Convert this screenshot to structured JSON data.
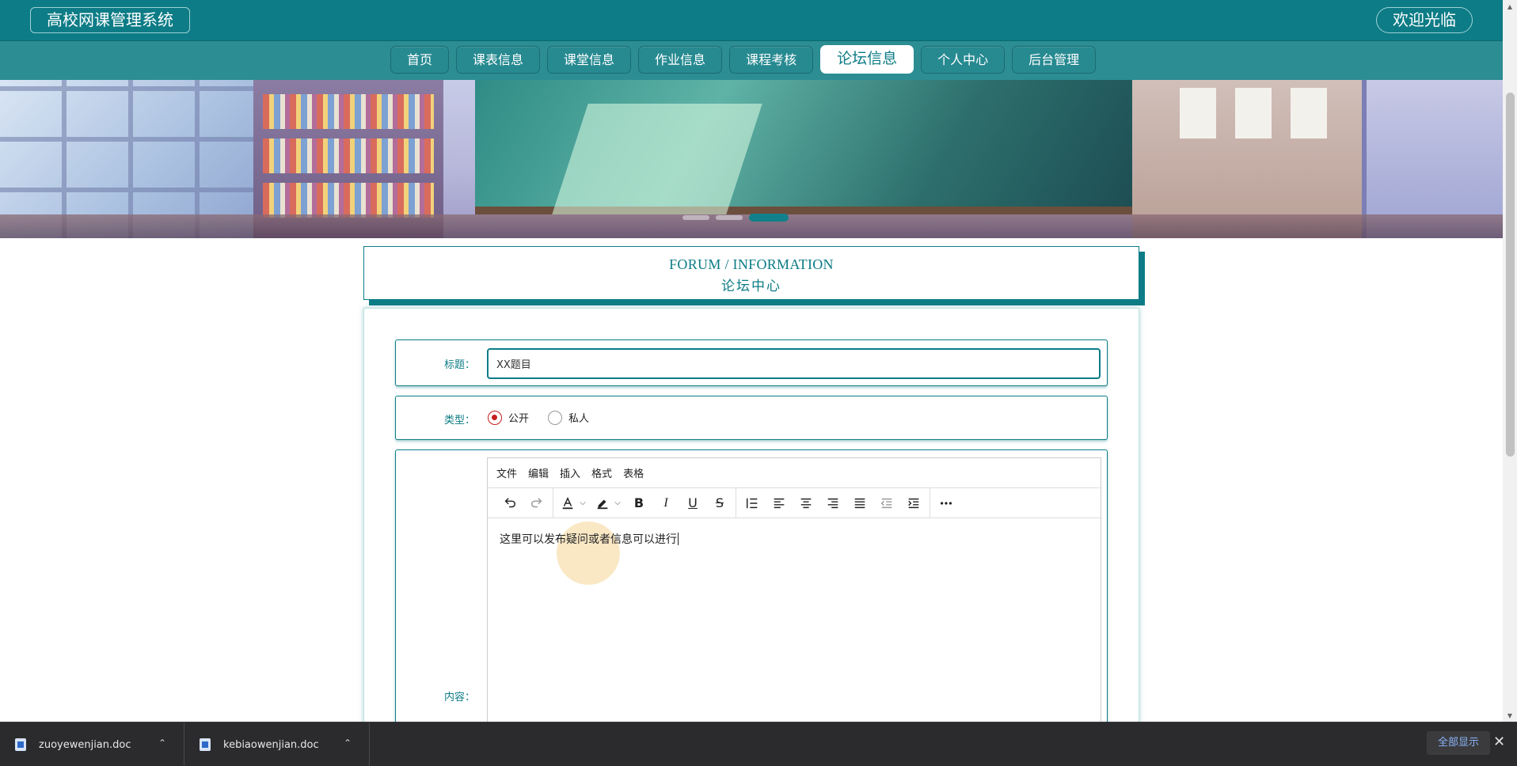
{
  "header": {
    "site_title": "高校网课管理系统",
    "welcome": "欢迎光临"
  },
  "nav": {
    "items": [
      {
        "label": "首页",
        "active": false
      },
      {
        "label": "课表信息",
        "active": false
      },
      {
        "label": "课堂信息",
        "active": false
      },
      {
        "label": "作业信息",
        "active": false
      },
      {
        "label": "课程考核",
        "active": false
      },
      {
        "label": "论坛信息",
        "active": true
      },
      {
        "label": "个人中心",
        "active": false
      },
      {
        "label": "后台管理",
        "active": false
      }
    ]
  },
  "banner": {
    "carousel_dots": 3,
    "active_dot": 2
  },
  "section": {
    "title_en": "FORUM / INFORMATION",
    "title_cn": "论坛中心"
  },
  "form": {
    "title_label": "标题：",
    "title_value": "XX题目",
    "type_label": "类型：",
    "type_options": [
      {
        "label": "公开",
        "checked": true
      },
      {
        "label": "私人",
        "checked": false
      }
    ],
    "content_label": "内容：",
    "editor": {
      "menu": [
        "文件",
        "编辑",
        "插入",
        "格式",
        "表格"
      ],
      "toolbar_icons": [
        "undo-icon",
        "redo-icon",
        "text-color-icon",
        "highlight-icon",
        "bold-icon",
        "italic-icon",
        "underline-icon",
        "strikethrough-icon",
        "line-height-icon",
        "align-left-icon",
        "align-center-icon",
        "align-right-icon",
        "align-justify-icon",
        "outdent-icon",
        "indent-icon",
        "more-icon"
      ],
      "content": "这里可以发布疑问或者信息可以进行"
    }
  },
  "downloads": {
    "items": [
      {
        "name": "zuoyewenjian.doc"
      },
      {
        "name": "kebiaowenjian.doc"
      }
    ],
    "show_all": "全部显示"
  },
  "colors": {
    "primary": "#0d7c86",
    "nav_bg": "#2c8d93",
    "radio_checked": "#c71d1d"
  }
}
